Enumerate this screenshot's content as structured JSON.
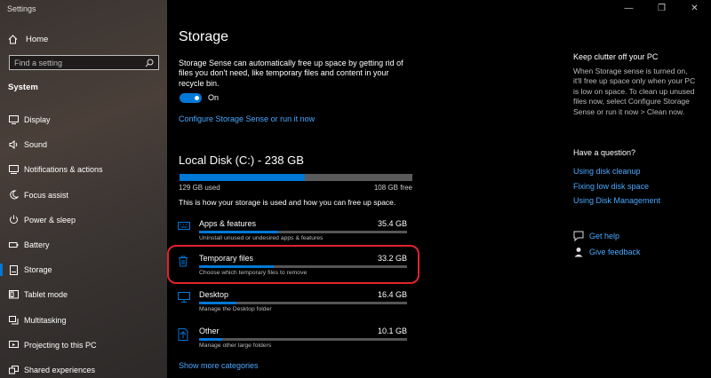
{
  "window": {
    "title": "Settings",
    "controls": [
      "—",
      "❐",
      "✕"
    ]
  },
  "sidebar": {
    "home_label": "Home",
    "search_placeholder": "Find a setting",
    "section": "System",
    "items": [
      {
        "label": "Display",
        "icon": "display-icon"
      },
      {
        "label": "Sound",
        "icon": "speaker-icon"
      },
      {
        "label": "Notifications & actions",
        "icon": "notification-icon"
      },
      {
        "label": "Focus assist",
        "icon": "moon-icon"
      },
      {
        "label": "Power & sleep",
        "icon": "power-icon"
      },
      {
        "label": "Battery",
        "icon": "battery-icon"
      },
      {
        "label": "Storage",
        "icon": "storage-icon",
        "active": true
      },
      {
        "label": "Tablet mode",
        "icon": "tablet-icon"
      },
      {
        "label": "Multitasking",
        "icon": "multitasking-icon"
      },
      {
        "label": "Projecting to this PC",
        "icon": "projector-icon"
      },
      {
        "label": "Shared experiences",
        "icon": "shared-icon"
      }
    ]
  },
  "main": {
    "title": "Storage",
    "description": "Storage Sense can automatically free up space by getting rid of files you don't need, like temporary files and content in your recycle bin.",
    "toggle_state": "On",
    "configure_link": "Configure Storage Sense or run it now",
    "disk": {
      "title": "Local Disk (C:) - 238 GB",
      "used_fraction": 0.54,
      "used_label": "129 GB used",
      "free_label": "108 GB free",
      "info": "This is how your storage is used and how you can free up space."
    },
    "categories": [
      {
        "name": "Apps & features",
        "size": "35.4 GB",
        "sub": "Uninstall unused or undesired apps & features",
        "fraction": 0.38,
        "icon": "keyboard-icon"
      },
      {
        "name": "Temporary files",
        "size": "33.2 GB",
        "sub": "Choose which temporary files to remove",
        "fraction": 0.36,
        "icon": "trash-icon"
      },
      {
        "name": "Desktop",
        "size": "16.4 GB",
        "sub": "Manage the Desktop folder",
        "fraction": 0.18,
        "icon": "monitor-icon"
      },
      {
        "name": "Other",
        "size": "10.1 GB",
        "sub": "Manage other large folders",
        "fraction": 0.11,
        "icon": "file-icon"
      }
    ],
    "show_more": "Show more categories"
  },
  "right": {
    "title": "Keep clutter off your PC",
    "description": "When Storage sense is turned on, it'll free up space only when your PC is low on space. To clean up unused files now, select Configure Storage Sense or run it now > Clean now.",
    "question": "Have a question?",
    "links": [
      "Using disk cleanup",
      "Fixing low disk space",
      "Using Disk Management"
    ],
    "get_help": "Get help",
    "give_feedback": "Give feedback"
  },
  "colors": {
    "accent": "#0078d7",
    "link": "#4aa8ff",
    "highlight": "#e0242b"
  }
}
